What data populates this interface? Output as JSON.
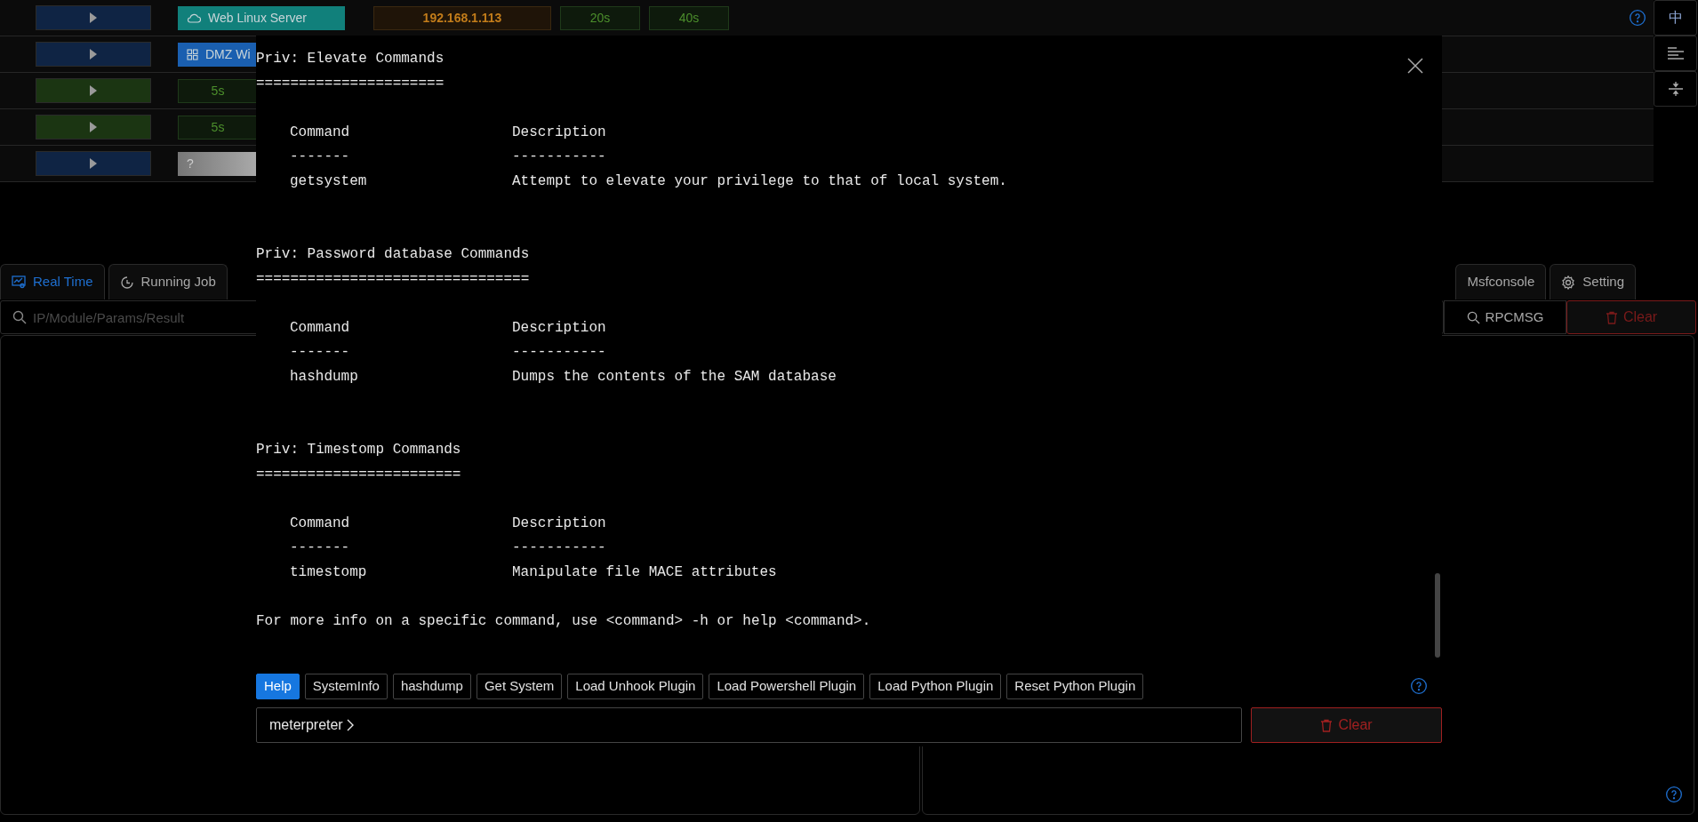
{
  "sessions": [
    {
      "color": "#0f2444",
      "cells": [
        {
          "kind": "linux_host",
          "label": "Web Linux Server",
          "color": "#11807b"
        },
        {
          "kind": "ip",
          "label": "192.168.1.113"
        },
        {
          "kind": "timer",
          "label": "20s"
        },
        {
          "kind": "timer",
          "label": "40s"
        }
      ]
    },
    {
      "color": "#0f2444",
      "cells": [
        {
          "kind": "windows_host",
          "label": "DMZ Wi",
          "color": "#1a5fb0"
        }
      ]
    },
    {
      "color": "#1b3512",
      "cells": [
        {
          "kind": "timer",
          "label": "5s"
        }
      ]
    },
    {
      "color": "#1b3512",
      "cells": [
        {
          "kind": "timer",
          "label": "5s"
        }
      ]
    },
    {
      "color": "#0f2444",
      "cells": [
        {
          "kind": "unknown",
          "label": "?"
        }
      ]
    }
  ],
  "side_buttons": [
    {
      "kind": "text",
      "label": "中"
    },
    {
      "kind": "align"
    },
    {
      "kind": "split"
    }
  ],
  "tabs_left": [
    {
      "kind": "monitor",
      "label": "Real Time",
      "selected": true
    },
    {
      "kind": "clock",
      "label": "Running Job",
      "selected": false
    }
  ],
  "tabs_right": [
    {
      "kind": "plain",
      "label": "Msfconsole",
      "selected": false
    },
    {
      "kind": "gear",
      "label": "Setting",
      "selected": false
    }
  ],
  "search": {
    "placeholder": "IP/Module/Params/Result"
  },
  "rpc_button": "RPCMSG",
  "clear_button": "Clear",
  "console": {
    "sections": [
      {
        "title": "Priv: Elevate Commands",
        "rule": "======================",
        "columns": [
          "Command",
          "Description"
        ],
        "dashes": [
          "-------",
          "-----------"
        ],
        "rows": [
          {
            "command": "getsystem",
            "description": "Attempt to elevate your privilege to that of local system."
          }
        ]
      },
      {
        "title": "Priv: Password database Commands",
        "rule": "================================",
        "columns": [
          "Command",
          "Description"
        ],
        "dashes": [
          "-------",
          "-----------"
        ],
        "rows": [
          {
            "command": "hashdump",
            "description": "Dumps the contents of the SAM database"
          }
        ]
      },
      {
        "title": "Priv: Timestomp Commands",
        "rule": "========================",
        "columns": [
          "Command",
          "Description"
        ],
        "dashes": [
          "-------",
          "-----------"
        ],
        "rows": [
          {
            "command": "timestomp",
            "description": "Manipulate file MACE attributes"
          }
        ]
      }
    ],
    "footer": "For more info on a specific command, use <command> -h or help <command>.",
    "quick_commands": [
      {
        "label": "Help",
        "selected": true
      },
      {
        "label": "SystemInfo",
        "selected": false
      },
      {
        "label": "hashdump",
        "selected": false
      },
      {
        "label": "Get System",
        "selected": false
      },
      {
        "label": "Load Unhook Plugin",
        "selected": false
      },
      {
        "label": "Load Powershell Plugin",
        "selected": false
      },
      {
        "label": "Load Python Plugin",
        "selected": false
      },
      {
        "label": "Reset Python Plugin",
        "selected": false
      }
    ],
    "prompt": "meterpreter",
    "clear_button": "Clear"
  }
}
